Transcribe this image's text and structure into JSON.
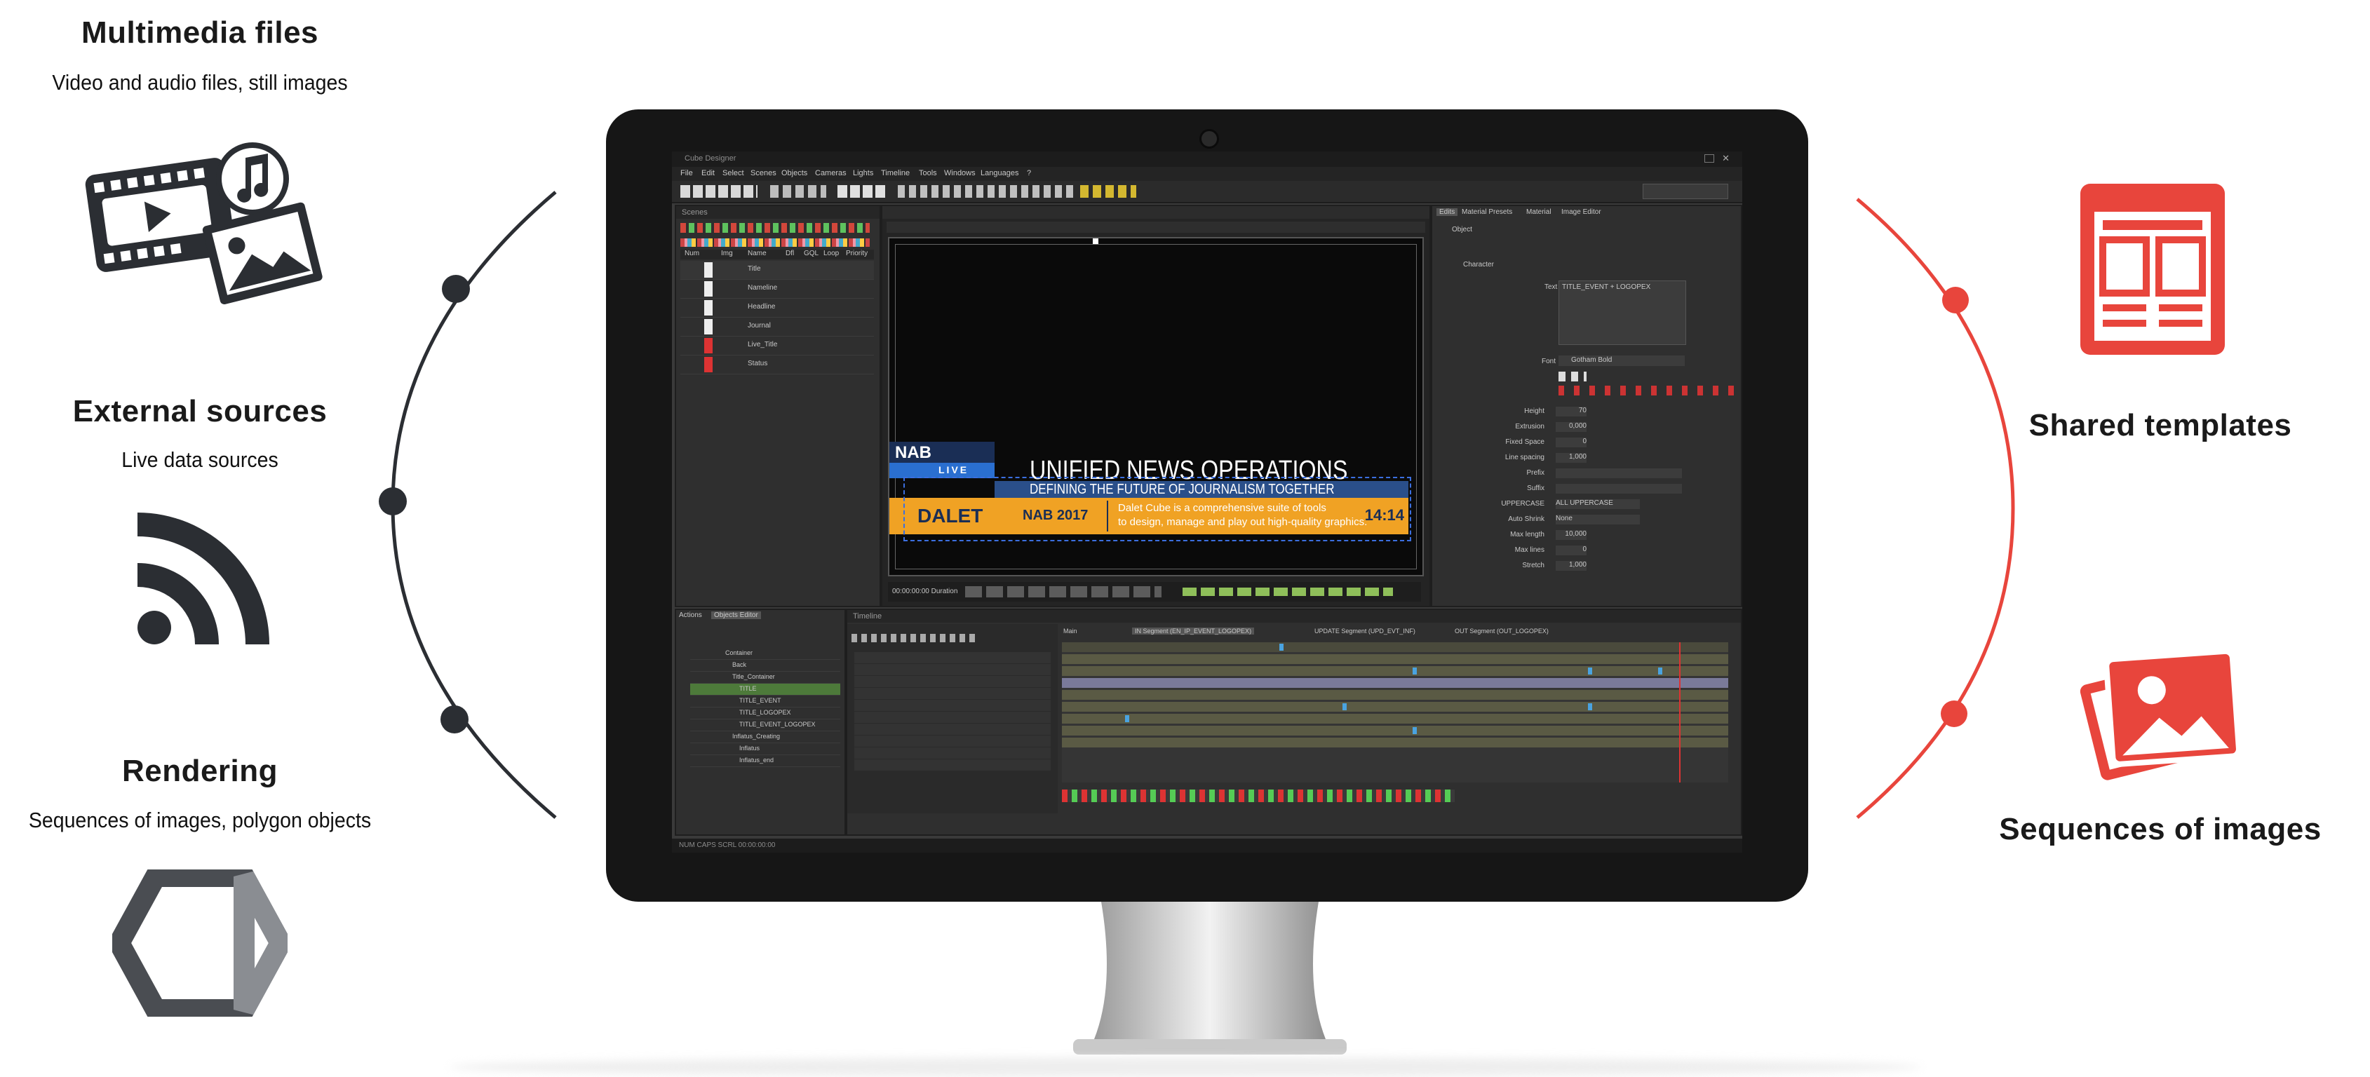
{
  "left": {
    "multimedia": {
      "title": "Multimedia files",
      "subtitle": "Video and audio files, still images",
      "icon": "media-files-icon"
    },
    "external": {
      "title": "External sources",
      "subtitle": "Live data sources",
      "icon": "rss-feed-icon"
    },
    "rendering": {
      "title": "Rendering",
      "subtitle": "Sequences of images, polygon objects",
      "icon": "hexagon-polygon-icon"
    }
  },
  "right": {
    "templates": {
      "title": "Shared templates",
      "icon": "template-layout-icon"
    },
    "sequences": {
      "title": "Sequences of images",
      "icon": "image-stack-icon"
    }
  },
  "colors": {
    "accent_red": "#e8453c",
    "dark": "#2b2e33",
    "graphic_orange": "#f0a224",
    "graphic_blue": "#2a6fd0"
  },
  "app": {
    "menu": [
      "File",
      "Edit",
      "Select",
      "Scenes",
      "Objects",
      "Cameras",
      "Lights",
      "Timeline",
      "Tools",
      "Windows",
      "Languages",
      "?"
    ],
    "scenes": {
      "title": "Scenes",
      "columns": [
        "Num",
        "Img",
        "Name",
        "Dfl",
        "GQL",
        "Loop",
        "Priority"
      ],
      "items": [
        "Title",
        "Nameline",
        "Headline",
        "Journal",
        "Live_Title",
        "Status"
      ]
    },
    "preview": {
      "headline": "UNIFIED NEWS OPERATIONS",
      "subheadline": "DEFINING THE FUTURE OF JOURNALISM TOGETHER",
      "brand": "DALET",
      "event": "NAB 2017",
      "body_line1": "Dalet Cube is a comprehensive suite of tools",
      "body_line2": "to design, manage and play out high-quality graphics.",
      "clock": "14:14",
      "logo_text": "NAB",
      "live_text": "LIVE"
    },
    "properties": {
      "tabs": [
        "Edits",
        "Material Presets",
        "Material",
        "Image Editor"
      ],
      "object_label": "Object",
      "character_label": "Character",
      "text_label": "Text",
      "text_value": "TITLE_EVENT + LOGOPEX",
      "font_label": "Font",
      "font_value": "Gotham Bold",
      "rows": [
        {
          "label": "Height",
          "value": "70"
        },
        {
          "label": "Extrusion",
          "value": "0,000"
        },
        {
          "label": "Fixed Space",
          "value": "0"
        },
        {
          "label": "Line spacing",
          "value": "1,000"
        },
        {
          "label": "Prefix",
          "value": ""
        },
        {
          "label": "Suffix",
          "value": ""
        },
        {
          "label": "UPPERCASE",
          "value": "ALL UPPERCASE"
        },
        {
          "label": "Auto Shrink",
          "value": "None"
        },
        {
          "label": "Max length",
          "value": "10,000"
        },
        {
          "label": "Max lines",
          "value": "0"
        },
        {
          "label": "Stretch",
          "value": "1,000"
        }
      ]
    },
    "objects": {
      "tabs": [
        "Actions",
        "Objects Editor"
      ],
      "items": [
        "Container",
        "Back",
        "Title_Container",
        "TITLE",
        "TITLE_EVENT",
        "TITLE_LOGOPEX",
        "TITLE_EVENT_LOGOPEX",
        "Inflatus_Creating",
        "Inflatus",
        "Inflatus_end"
      ]
    },
    "timeline": {
      "title": "Timeline",
      "tabs": [
        "Main",
        "IN Segment (EN_IP_EVENT_LOGOPEX)",
        "UPDATE Segment (UPD_EVT_INF)",
        "OUT Segment (OUT_LOGOPEX)"
      ]
    },
    "transport": {
      "timecode": "00:00:00:00 Duration"
    },
    "status": "NUM CAPS SCRL 00:00:00:00"
  }
}
